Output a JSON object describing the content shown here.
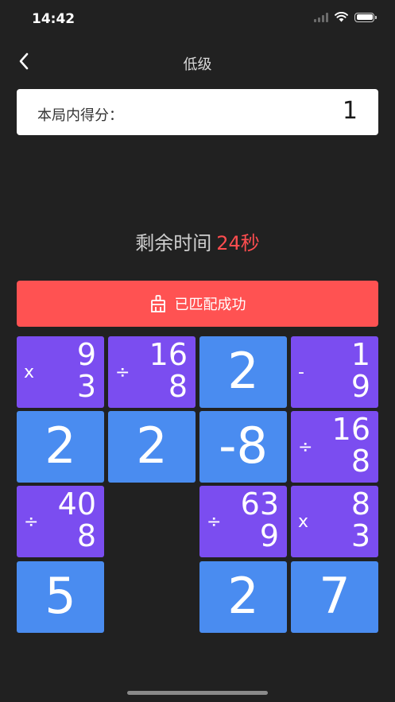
{
  "status_bar": {
    "time": "14:42"
  },
  "nav": {
    "title": "低级",
    "back_icon": "chevron-left-icon"
  },
  "score": {
    "label": "本局内得分：",
    "value": "1"
  },
  "timer": {
    "label": "剩余时间",
    "value": "24秒"
  },
  "match_banner": {
    "icon": "broom-icon",
    "label": "已匹配成功"
  },
  "colors": {
    "number_tile": "#4a8cf0",
    "operation_tile": "#7b4df0",
    "banner": "#ff5252",
    "timer_value": "#ff4d4f",
    "background": "#212121"
  },
  "board": {
    "rows": [
      [
        {
          "type": "op",
          "op": "x",
          "top": "9",
          "bottom": "3"
        },
        {
          "type": "op",
          "op": "÷",
          "top": "16",
          "bottom": "8"
        },
        {
          "type": "num",
          "value": "2"
        },
        {
          "type": "op",
          "op": "-",
          "top": "1",
          "bottom": "9"
        }
      ],
      [
        {
          "type": "num",
          "value": "2"
        },
        {
          "type": "num",
          "value": "2"
        },
        {
          "type": "num",
          "value": "-8"
        },
        {
          "type": "op",
          "op": "÷",
          "top": "16",
          "bottom": "8"
        }
      ],
      [
        {
          "type": "op",
          "op": "÷",
          "top": "40",
          "bottom": "8"
        },
        {
          "type": "empty"
        },
        {
          "type": "op",
          "op": "÷",
          "top": "63",
          "bottom": "9"
        },
        {
          "type": "op",
          "op": "x",
          "top": "8",
          "bottom": "3"
        }
      ],
      [
        {
          "type": "num",
          "value": "5"
        },
        {
          "type": "empty"
        },
        {
          "type": "num",
          "value": "2"
        },
        {
          "type": "num",
          "value": "7"
        }
      ]
    ]
  }
}
